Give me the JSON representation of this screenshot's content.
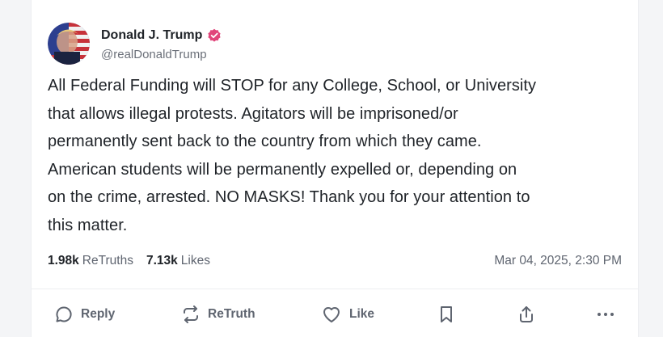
{
  "author": {
    "display_name": "Donald J. Trump",
    "handle": "@realDonaldTrump",
    "verified": true,
    "verified_color": "#e1457a"
  },
  "post": {
    "lines": [
      "All Federal Funding will STOP for any College, School, or University",
      "that allows illegal protests. Agitators will be imprisoned/or",
      "permanently sent back to the country from which they came.",
      "American students will be permanently expelled or, depending on",
      "on the crime, arrested. NO MASKS! Thank you for your attention to",
      "this matter."
    ]
  },
  "stats": {
    "retruths_count": "1.98k",
    "retruths_label": "ReTruths",
    "likes_count": "7.13k",
    "likes_label": "Likes",
    "timestamp": "Mar 04, 2025, 2:30 PM"
  },
  "actions": {
    "reply_label": "Reply",
    "retruth_label": "ReTruth",
    "like_label": "Like",
    "bookmark_icon": "bookmark-icon",
    "share_icon": "share-icon",
    "more_icon": "more-icon"
  }
}
